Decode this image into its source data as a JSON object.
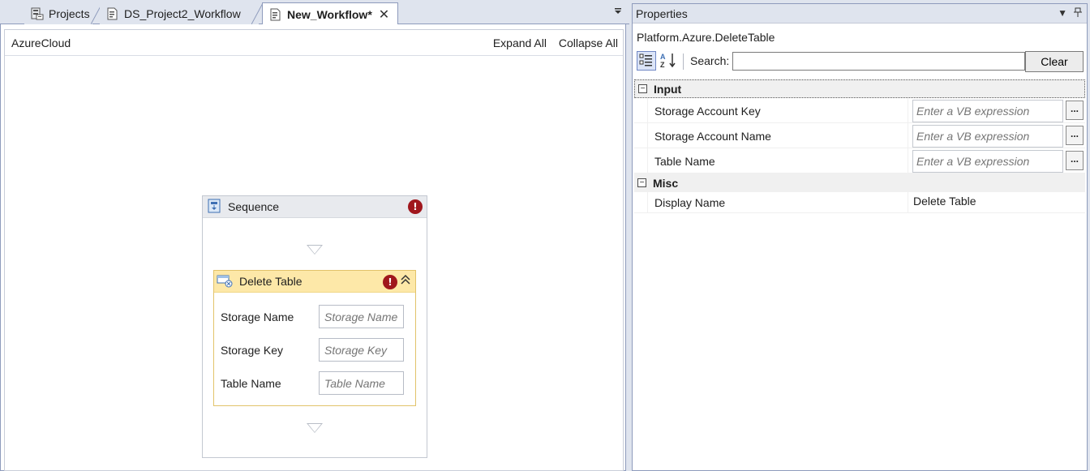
{
  "tabs": [
    {
      "label": "Projects",
      "icon": "projects-icon"
    },
    {
      "label": "DS_Project2_Workflow",
      "icon": "workflow-file-icon"
    },
    {
      "label": "New_Workflow*",
      "icon": "workflow-file-icon",
      "active": true
    }
  ],
  "designer": {
    "breadcrumb": "AzureCloud",
    "expand_all": "Expand All",
    "collapse_all": "Collapse All",
    "sequence": {
      "title": "Sequence",
      "icon": "sequence-icon",
      "activity": {
        "title": "Delete Table",
        "icon": "azure-table-delete-icon",
        "fields": [
          {
            "label": "Storage Name",
            "placeholder": "Storage Name"
          },
          {
            "label": "Storage Key",
            "placeholder": "Storage Key"
          },
          {
            "label": "Table Name",
            "placeholder": "Table Name"
          }
        ]
      }
    }
  },
  "properties": {
    "title": "Properties",
    "type_name": "Platform.Azure.DeleteTable",
    "search_label": "Search:",
    "search_value": "",
    "clear_label": "Clear",
    "categories": [
      {
        "name": "Input",
        "toggle": "−",
        "rows": [
          {
            "name": "Storage Account Key",
            "placeholder": "Enter a VB expression",
            "button": "..."
          },
          {
            "name": "Storage Account Name",
            "placeholder": "Enter a VB expression",
            "button": "..."
          },
          {
            "name": "Table Name",
            "placeholder": "Enter a VB expression",
            "button": "..."
          }
        ]
      },
      {
        "name": "Misc",
        "toggle": "−",
        "rows": [
          {
            "name": "Display Name",
            "value": "Delete Table"
          }
        ]
      }
    ]
  },
  "colors": {
    "error": "#a0171d",
    "activity_header": "#fde8a8",
    "activity_border": "#e2c36a",
    "chrome": "#dfe4ee"
  }
}
